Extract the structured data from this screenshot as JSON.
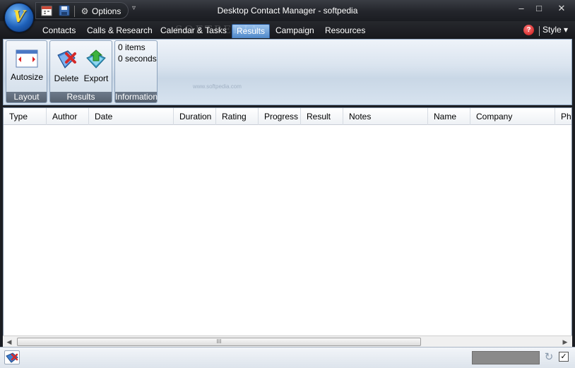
{
  "window": {
    "title": "Desktop Contact Manager - softpedia",
    "minimize_glyph": "–",
    "maximize_glyph": "□",
    "close_glyph": "✕"
  },
  "quick_access": {
    "options_label": "Options",
    "more_glyph": "▿"
  },
  "menu": {
    "tabs": [
      "Contacts",
      "Calls & Research",
      "Calendar & Tasks",
      "Results",
      "Campaign",
      "Resources"
    ],
    "active_tab": "Results",
    "style_label": "Style ▾",
    "help_glyph": "?"
  },
  "ribbon": {
    "layout": {
      "label": "Layout",
      "autosize_label": "Autosize"
    },
    "results": {
      "label": "Results",
      "delete_label": "Delete",
      "export_label": "Export"
    },
    "information": {
      "label": "Information",
      "items_text": "0 items",
      "duration_text": "0 seconds"
    }
  },
  "grid": {
    "columns": [
      "Type",
      "Author",
      "Date",
      "Duration",
      "Rating",
      "Progress",
      "Result",
      "Notes",
      "Name",
      "Company",
      "Ph"
    ],
    "rows": []
  },
  "scrollbar": {
    "left_arrow": "◀",
    "right_arrow": "▶",
    "grip": "III"
  },
  "statusbar": {
    "refresh_glyph": "↻",
    "check_glyph": "✓"
  },
  "watermark": {
    "text": "SOFTPEDIA",
    "url": "www.softpedia.com"
  },
  "colors": {
    "accent": "#4f88c9",
    "titlebar": "#23252b",
    "ribbon": "#dae4ef"
  },
  "icons": [
    "app-orb-icon",
    "calendar-icon",
    "save-icon",
    "gear-icon",
    "help-icon",
    "autosize-icon",
    "delete-icon",
    "export-icon",
    "status-app-icon",
    "refresh-icon"
  ]
}
